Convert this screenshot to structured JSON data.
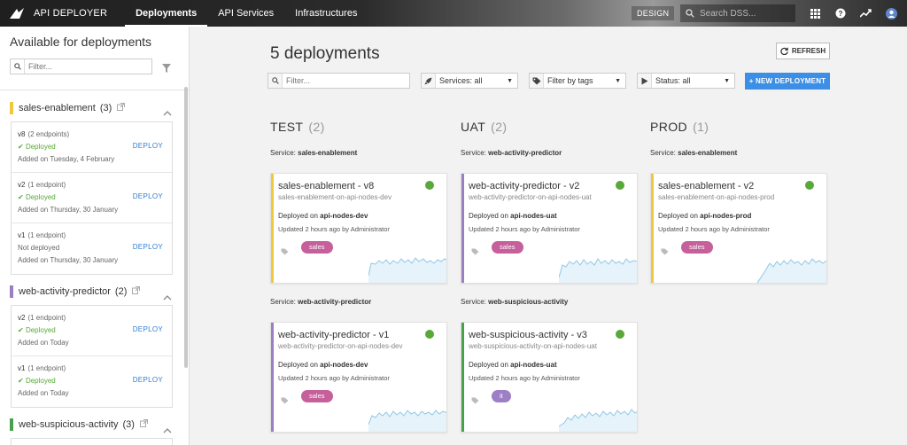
{
  "topbar": {
    "app_title": "API DEPLOYER",
    "nav": [
      "Deployments",
      "API Services",
      "Infrastructures"
    ],
    "active_nav": "Deployments",
    "design_label": "DESIGN",
    "search_placeholder": "Search DSS..."
  },
  "sidebar": {
    "title": "Available for deployments",
    "filter_placeholder": "Filter...",
    "groups": [
      {
        "name": "sales-enablement",
        "count": "(3)",
        "color": "#f0c93b",
        "versions": [
          {
            "version": "v8",
            "endpoints": "(2 endpoints)",
            "status": "Deployed",
            "deployed": true,
            "added": "Added on Tuesday, 4 February",
            "action": "DEPLOY"
          },
          {
            "version": "v2",
            "endpoints": "(1 endpoint)",
            "status": "Deployed",
            "deployed": true,
            "added": "Added on Thursday, 30 January",
            "action": "DEPLOY"
          },
          {
            "version": "v1",
            "endpoints": "(1 endpoint)",
            "status": "Not deployed",
            "deployed": false,
            "added": "Added on Thursday, 30 January",
            "action": "DEPLOY"
          }
        ]
      },
      {
        "name": "web-activity-predictor",
        "count": "(2)",
        "color": "#9b7fc0",
        "versions": [
          {
            "version": "v2",
            "endpoints": "(1 endpoint)",
            "status": "Deployed",
            "deployed": true,
            "added": "Added on Today",
            "action": "DEPLOY"
          },
          {
            "version": "v1",
            "endpoints": "(1 endpoint)",
            "status": "Deployed",
            "deployed": true,
            "added": "Added on Today",
            "action": "DEPLOY"
          }
        ]
      },
      {
        "name": "web-suspicious-activity",
        "count": "(3)",
        "color": "#4aa04a",
        "versions": []
      }
    ]
  },
  "main": {
    "title": "5 deployments",
    "refresh_label": "REFRESH",
    "filter_placeholder": "Filter...",
    "services_filter": "Services: all",
    "tags_filter": "Filter by tags",
    "status_filter": "Status: all",
    "new_deployment_label": "+ NEW DEPLOYMENT",
    "columns": [
      {
        "name": "TEST",
        "count": "(2)"
      },
      {
        "name": "UAT",
        "count": "(2)"
      },
      {
        "name": "PROD",
        "count": "(1)"
      }
    ],
    "service_prefix": "Service: ",
    "deployed_prefix": "Deployed on ",
    "cards": [
      {
        "service": "sales-enablement",
        "name": "sales-enablement - v8",
        "id": "sales-enablement-on-api-nodes-dev",
        "infra": "api-nodes-dev",
        "updated": "Updated 2 hours ago by Administrator",
        "tag": "sales",
        "tag_color": "#c5609a",
        "stripe": "#f0c93b",
        "status_color": "#58a83a"
      },
      {
        "service": "web-activity-predictor",
        "name": "web-activity-predictor - v2",
        "id": "web-activity-predictor-on-api-nodes-uat",
        "infra": "api-nodes-uat",
        "updated": "Updated 2 hours ago by Administrator",
        "tag": "sales",
        "tag_color": "#c5609a",
        "stripe": "#9b7fc0",
        "status_color": "#58a83a"
      },
      {
        "service": "sales-enablement",
        "name": "sales-enablement - v2",
        "id": "sales-enablement-on-api-nodes-prod",
        "infra": "api-nodes-prod",
        "updated": "Updated 2 hours ago by Administrator",
        "tag": "sales",
        "tag_color": "#c5609a",
        "stripe": "#f0c93b",
        "status_color": "#58a83a"
      },
      {
        "service": "web-activity-predictor",
        "name": "web-activity-predictor - v1",
        "id": "web-activity-predictor-on-api-nodes-dev",
        "infra": "api-nodes-dev",
        "updated": "Updated 2 hours ago by Administrator",
        "tag": "sales",
        "tag_color": "#c5609a",
        "stripe": "#9b7fc0",
        "status_color": "#58a83a"
      },
      {
        "service": "web-suspicious-activity",
        "name": "web-suspicious-activity - v3",
        "id": "web-suspicious-activity-on-api-nodes-uat",
        "infra": "api-nodes-uat",
        "updated": "Updated 2 hours ago by Administrator",
        "tag": "it",
        "tag_color": "#9c7fc4",
        "stripe": "#4aa04a",
        "status_color": "#58a83a"
      }
    ]
  },
  "colors": {
    "accent": "#3c8fe4",
    "deployed_green": "#58a83a",
    "link_blue": "#2e7dd1",
    "sparkline": "#8fc8e6"
  }
}
